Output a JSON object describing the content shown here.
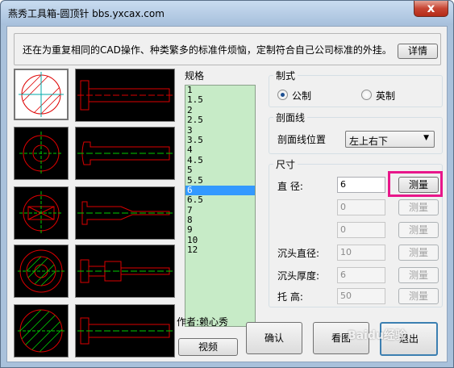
{
  "window": {
    "title": "燕秀工具箱-圆顶针  bbs.yxcax.com",
    "close_label": "x"
  },
  "description": {
    "text": "还在为重复相同的CAD操作、种类繁多的标准件烦恼，定制符合自己公司标准的外挂。",
    "details_button": "详情"
  },
  "spec": {
    "label": "规格",
    "items": [
      "1",
      "1.5",
      "2",
      "2.5",
      "3",
      "3.5",
      "4",
      "4.5",
      "5",
      "5.5",
      "6",
      "6.5",
      "7",
      "8",
      "9",
      "10",
      "12"
    ],
    "selected": "6"
  },
  "style_group": {
    "title": "制式",
    "metric": "公制",
    "imperial": "英制",
    "selected": "公制"
  },
  "hatch_group": {
    "title": "剖面线",
    "position_label": "剖面线位置",
    "position_value": "左上右下"
  },
  "size_group": {
    "title": "尺寸",
    "diameter_label": "直    径:",
    "diameter_value": "6",
    "field2_value": "0",
    "field3_value": "0",
    "head_diameter_label": "沉头直径:",
    "head_diameter_value": "10",
    "head_thickness_label": "沉头厚度:",
    "head_thickness_value": "6",
    "holder_height_label": "托    高:",
    "holder_height_value": "50",
    "measure_label": "测量"
  },
  "author": {
    "text": "作者:赖心秀"
  },
  "buttons": {
    "video": "视频",
    "confirm": "确认",
    "preview": "看图",
    "exit": "退出"
  },
  "watermark": {
    "text": "Baidu经验"
  },
  "colors": {
    "accent_highlight": "#e8168a",
    "list_bg": "#c7ebc7",
    "selection": "#3399ff"
  }
}
